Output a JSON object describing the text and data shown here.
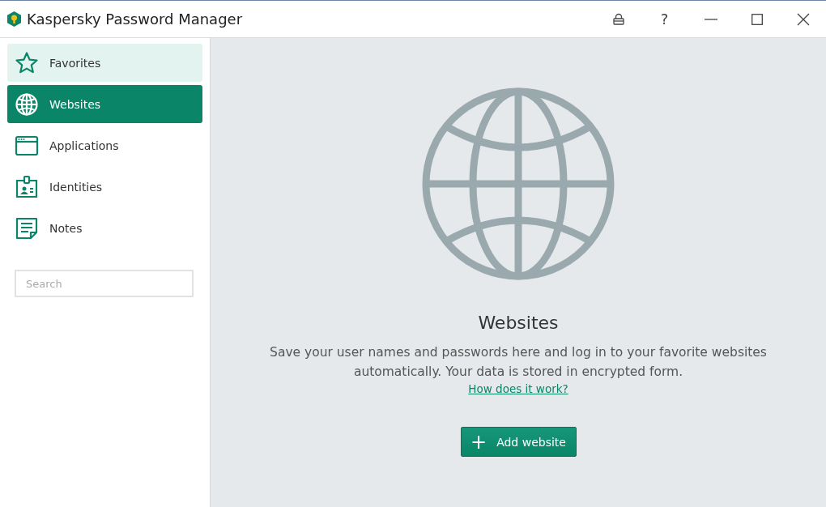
{
  "window": {
    "title": "Kaspersky Password Manager",
    "controls": [
      {
        "kind": "lock"
      },
      {
        "kind": "help",
        "label": "?"
      },
      {
        "kind": "minimize"
      },
      {
        "kind": "maximize"
      },
      {
        "kind": "close"
      }
    ]
  },
  "sidebar": {
    "items": [
      {
        "kind": "star",
        "label": "Favorites",
        "selected": false,
        "highlighted": true
      },
      {
        "kind": "globe",
        "label": "Websites",
        "selected": true,
        "highlighted": false
      },
      {
        "kind": "window",
        "label": "Applications",
        "selected": false,
        "highlighted": false
      },
      {
        "kind": "idcard",
        "label": "Identities",
        "selected": false,
        "highlighted": false
      },
      {
        "kind": "note",
        "label": "Notes",
        "selected": false,
        "highlighted": false
      }
    ],
    "search": {
      "placeholder": "Search"
    }
  },
  "main": {
    "title": "Websites",
    "description": "Save your user names and passwords here and log in to your favorite websites automatically. Your data is stored in encrypted form.",
    "link": "How does it work?",
    "button": {
      "icon": "+",
      "label": "Add website"
    }
  }
}
